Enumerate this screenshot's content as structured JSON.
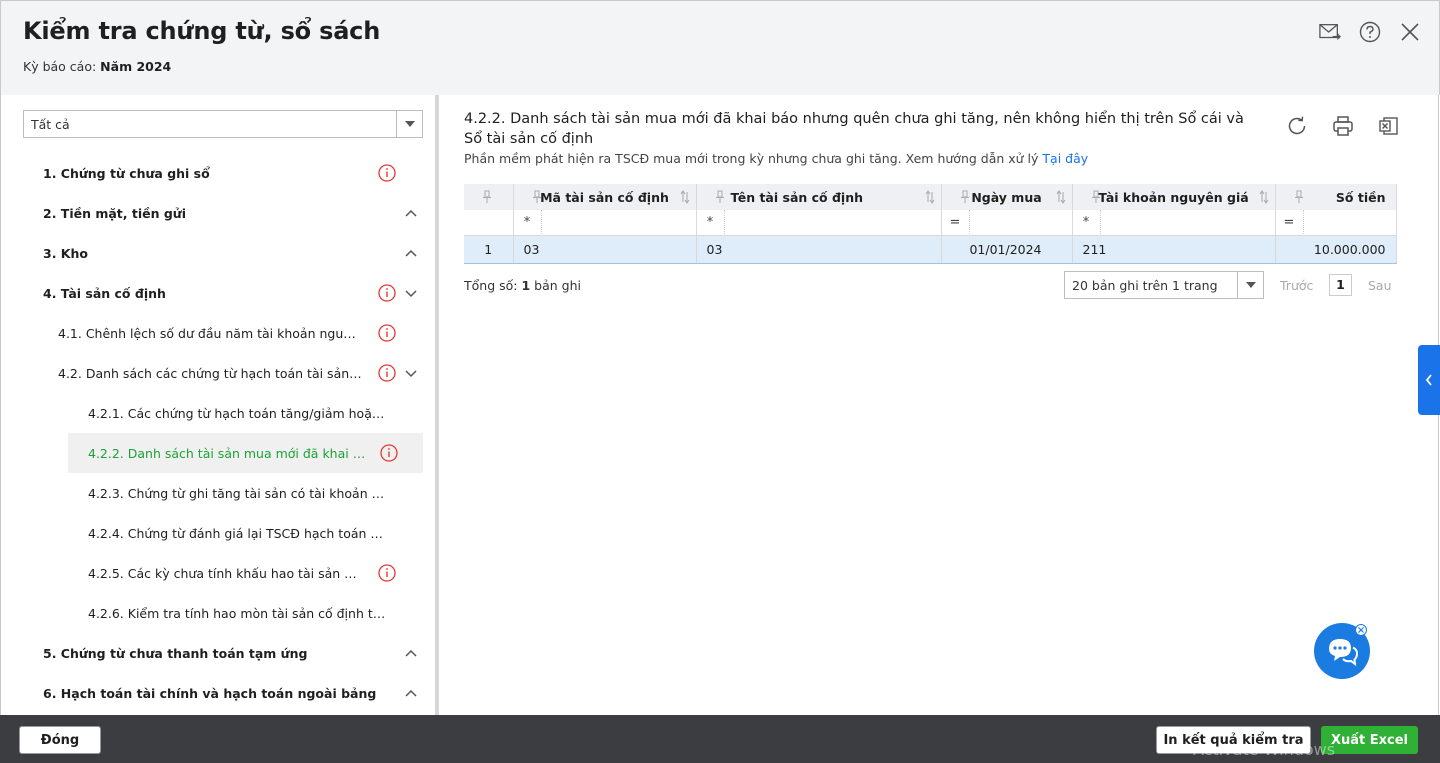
{
  "header": {
    "title": "Kiểm tra chứng từ, sổ sách",
    "period_label": "Kỳ báo cáo:",
    "period_value": "Năm 2024"
  },
  "sidebar": {
    "filter_value": "Tất cả",
    "items": [
      {
        "label": "1. Chứng từ chưa ghi sổ"
      },
      {
        "label": "2. Tiền mặt, tiền gửi"
      },
      {
        "label": "3. Kho"
      },
      {
        "label": "4. Tài sản cố định"
      },
      {
        "label": "4.1. Chênh lệch số dư đầu năm tài khoản nguyê..."
      },
      {
        "label": "4.2. Danh sách các chứng từ hạch toán tài sản tr..."
      },
      {
        "label": "4.2.1. Các chứng từ hạch toán tăng/giảm hoặc t..."
      },
      {
        "label": "4.2.2. Danh sách tài sản mua mới đã khai bá..."
      },
      {
        "label": "4.2.3. Chứng từ ghi tăng tài sản có tài khoản ho..."
      },
      {
        "label": "4.2.4. Chứng từ đánh giá lại TSCĐ hạch toán số ..."
      },
      {
        "label": "4.2.5. Các kỳ chưa tính khấu hao tài sản cố ..."
      },
      {
        "label": "4.2.6. Kiểm tra tính hao mòn tài sản cố định tro..."
      },
      {
        "label": "5. Chứng từ chưa thanh toán tạm ứng"
      },
      {
        "label": "6. Hạch toán tài chính và hạch toán ngoài bảng"
      }
    ]
  },
  "main": {
    "title": "4.2.2. Danh sách tài sản mua mới đã khai báo nhưng quên chưa ghi tăng, nên không hiển thị trên Sổ cái và Sổ tài sản cố định",
    "description": "Phần mềm phát hiện ra TSCĐ mua mới trong kỳ nhưng chưa ghi tăng. Xem hướng dẫn xử lý",
    "help_link": "Tại đây",
    "columns": {
      "code": "Mã tài sản cố định",
      "name": "Tên tài sản cố định",
      "date": "Ngày mua",
      "account": "Tài khoản nguyên giá",
      "amount": "Số tiền"
    },
    "filters": {
      "code": "*",
      "name": "*",
      "date": "=",
      "account": "*",
      "amount": "="
    },
    "rows": [
      {
        "index": "1",
        "code": "03",
        "name": "03",
        "date": "01/01/2024",
        "account": "211",
        "amount": "10.000.000"
      }
    ],
    "pager": {
      "total_label": "Tổng số:",
      "total_value": "1",
      "total_suffix": "bản ghi",
      "page_size": "20 bản ghi trên 1 trang",
      "prev": "Trước",
      "page": "1",
      "next": "Sau"
    }
  },
  "footer": {
    "close_label": "Đóng",
    "print_label": "In kết quả kiểm tra",
    "excel_label": "Xuất Excel",
    "watermark": "Activate Windows"
  },
  "colors": {
    "accent": "#1a73e8",
    "selected_text": "#1aa336",
    "warning": "#e53935",
    "excel_button": "#2eb134",
    "footer_bg": "#3c3d41"
  }
}
